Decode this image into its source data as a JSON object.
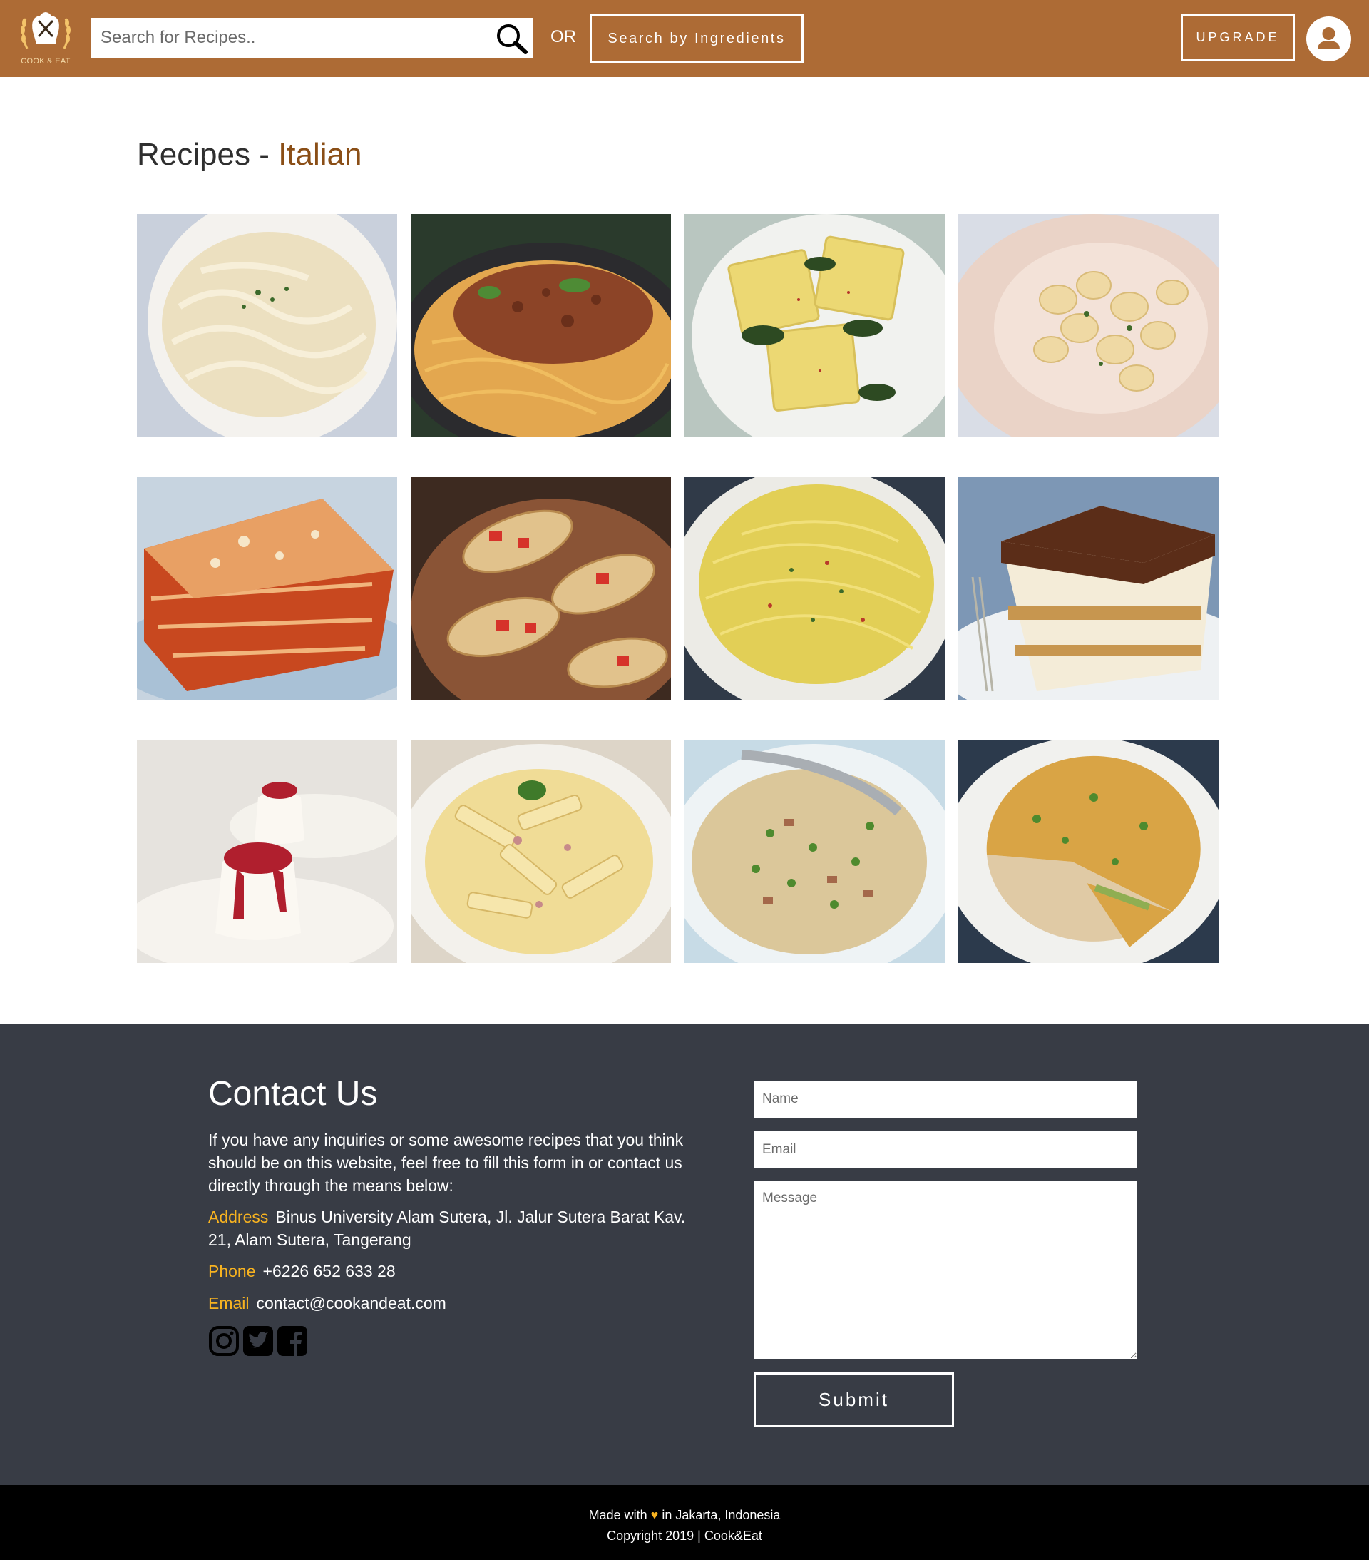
{
  "header": {
    "logo_text": "COOK & EAT",
    "search_placeholder": "Search for Recipes..",
    "or_label": "OR",
    "ingredients_button": "Search by Ingredients",
    "upgrade_button": "UPGRADE",
    "brand_color": "#ad6b35"
  },
  "main": {
    "title_prefix": "Recipes - ",
    "title_category": "Italian",
    "recipes": [
      {
        "name": "fettuccine-alfredo"
      },
      {
        "name": "spaghetti-bolognese"
      },
      {
        "name": "ravioli-spinach"
      },
      {
        "name": "gnocchi"
      },
      {
        "name": "lasagna"
      },
      {
        "name": "bruschetta"
      },
      {
        "name": "spaghetti-aglio-olio"
      },
      {
        "name": "tiramisu"
      },
      {
        "name": "panna-cotta"
      },
      {
        "name": "penne-carbonara"
      },
      {
        "name": "risotto-peas"
      },
      {
        "name": "frittata"
      }
    ]
  },
  "contact": {
    "heading": "Contact Us",
    "intro": "If you have any inquiries or some awesome recipes that you think should be on this website, feel free to fill this form in or contact us directly through the means below:",
    "address_label": "Address",
    "address_value": "Binus University Alam Sutera, Jl. Jalur Sutera Barat Kav. 21, Alam Sutera, Tangerang",
    "phone_label": "Phone",
    "phone_value": "+6226 652 633 28",
    "email_label": "Email",
    "email_value": "contact@cookandeat.com",
    "socials": [
      "instagram-icon",
      "twitter-icon",
      "facebook-icon"
    ],
    "form": {
      "name_placeholder": "Name",
      "email_placeholder": "Email",
      "message_placeholder": "Message",
      "submit_label": "Submit"
    },
    "accent_color": "#f8b320",
    "background_color": "#383c45"
  },
  "footer": {
    "made_with_prefix": "Made with",
    "made_with_suffix": "in Jakarta, Indonesia",
    "copyright": "Copyright 2019 | Cook&Eat"
  }
}
